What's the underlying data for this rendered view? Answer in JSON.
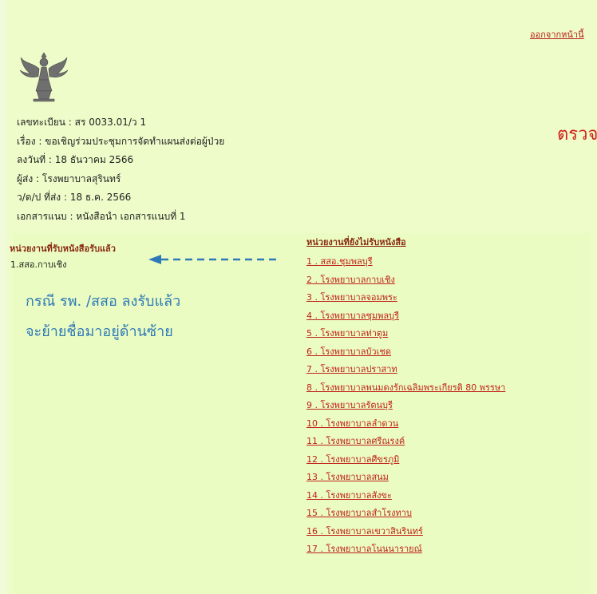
{
  "header": {
    "logout_link": "ออกจากหน้านี้"
  },
  "document": {
    "reg_no": "เลขทะเบียน : สร 0033.01/ว 1",
    "subject": "เรื่อง : ขอเชิญร่วมประชุมการจัดทำแผนส่งต่อผู้ป่วย",
    "date": "ลงวันที่ : 18 ธันวาคม 2566",
    "sender": "ผู้ส่ง : โรงพยาบาลสุรินทร์",
    "sent_date": "ว/ด/ป ที่ส่ง : 18 ธ.ค. 2566",
    "attachment": "เอกสารแนบ : หนังสือนำ เอกสารแนบที่ 1"
  },
  "title_fragment": "ตรวจ",
  "received": {
    "heading": "หน่วยงานที่รับหนังสือรับแล้ว",
    "items": [
      "1.สสอ.กาบเชิง"
    ]
  },
  "annotation": {
    "line1": "กรณี รพ. /สสอ ลงรับแล้ว",
    "line2": "จะย้ายชื่อมาอยู่ด้านซ้าย",
    "arrow_color": "#2e79b8"
  },
  "pending": {
    "heading": "หน่วยงานที่ยังไม่รับหนังสือ",
    "items": [
      "1 . สสอ.ชุมพลบุรี",
      "2 . โรงพยาบาลกาบเชิง",
      "3 . โรงพยาบาลจอมพระ",
      "4 . โรงพยาบาลชุมพลบุรี",
      "5 . โรงพยาบาลท่าตูม",
      "6 . โรงพยาบาลบัวเชด",
      "7 . โรงพยาบาลปราสาท",
      "8 . โรงพยาบาลพนมดงรักเฉลิมพระเกียรติ 80 พรรษา",
      "9 . โรงพยาบาลรัตนบุรี",
      "10 . โรงพยาบาลลำดวน",
      "11 . โรงพยาบาลศรีณรงค์",
      "12 . โรงพยาบาลศีขรภูมิ",
      "13 . โรงพยาบาลสนม",
      "14 . โรงพยาบาลสังขะ",
      "15 . โรงพยาบาลสำโรงทาบ",
      "16 . โรงพยาบาลเขวาสินรินทร์",
      "17 . โรงพยาบาลโนนนารายณ์"
    ]
  }
}
